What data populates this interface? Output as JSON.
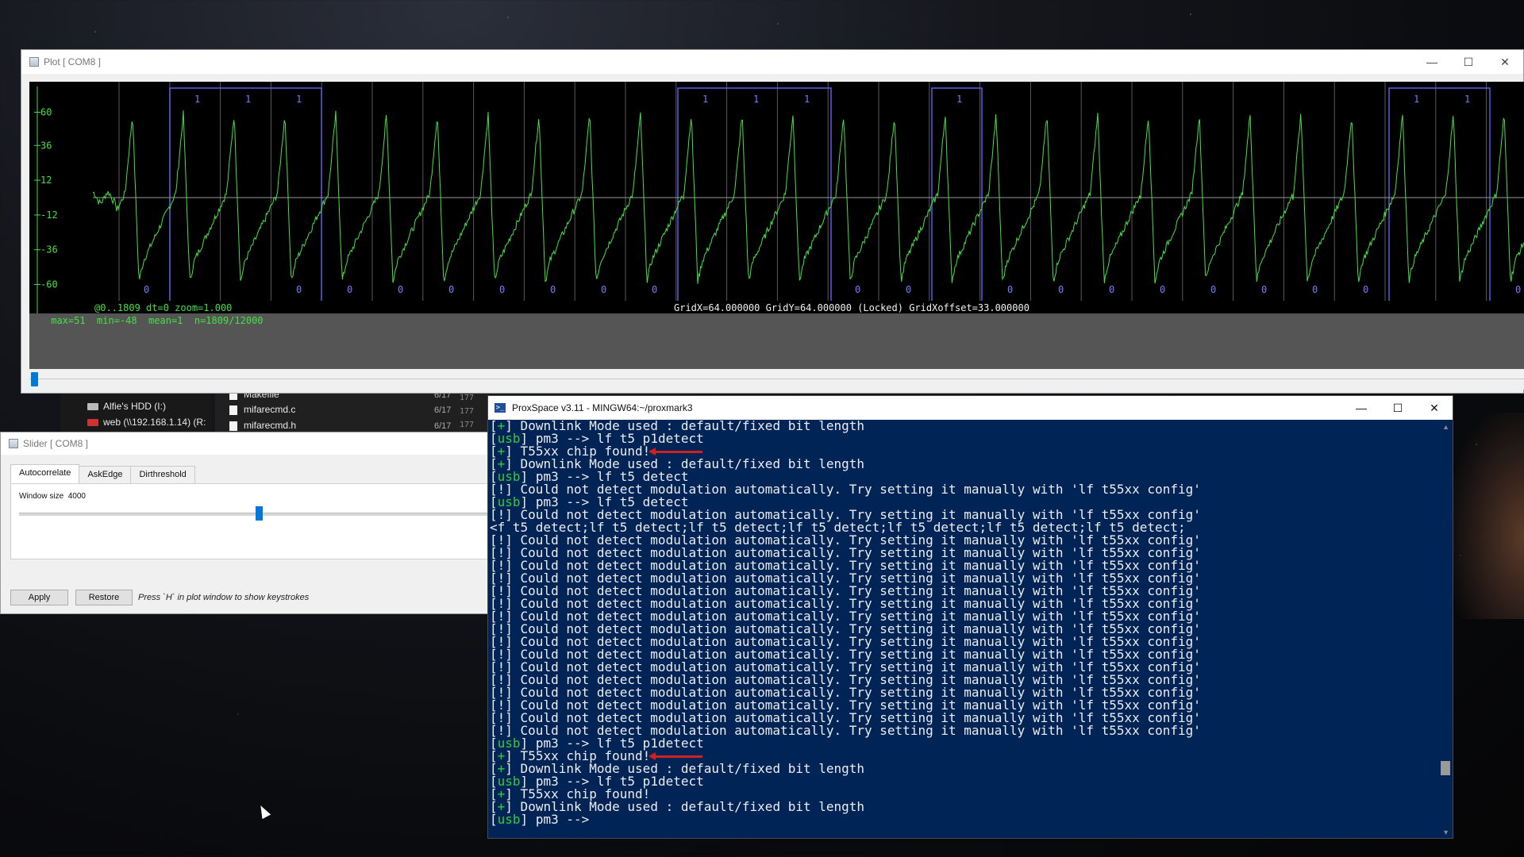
{
  "plot_window": {
    "title": "Plot [ COM8 ]",
    "controls": {
      "minimize": "—",
      "maximize": "☐",
      "close": "✕"
    },
    "y_ticks": [
      "60",
      "36",
      "12",
      "-12",
      "-36",
      "-60"
    ],
    "status_left": "@0..1809  dt=0  zoom=1.000",
    "status_grid": "GridX=64.000000  GridY=64.000000 (Locked) GridXoffset=33.000000",
    "stats": " max=51  min=-48  mean=1  n=1809/12000",
    "bit_labels_top": [
      "1",
      "1",
      "1",
      "1",
      "1",
      "1",
      "1",
      "1",
      "1"
    ],
    "bit_labels_bottom": [
      "0",
      "0",
      "0",
      "0",
      "0",
      "0",
      "0",
      "0",
      "0",
      "0",
      "0",
      "0",
      "0",
      "0",
      "0",
      "0",
      "0",
      "0",
      "0",
      "0"
    ]
  },
  "explorer": {
    "drives": [
      {
        "label": "Alfie's HDD (I:)",
        "icon": "drive-icon"
      },
      {
        "label": "web (\\\\192.168.1.14) (R:",
        "icon": "network-drive-icon"
      }
    ],
    "files": [
      {
        "name": "Makefile",
        "date": "6/17"
      },
      {
        "name": "mifarecmd.c",
        "date": "6/17"
      },
      {
        "name": "mifarecmd.h",
        "date": "6/17"
      }
    ],
    "line_numbers": [
      "177",
      "177",
      "177"
    ]
  },
  "slider_window": {
    "title": "Slider [ COM8 ]",
    "tabs": [
      "Autocorrelate",
      "AskEdge",
      "Dirthreshold"
    ],
    "active_tab": "Autocorrelate",
    "window_size_label": "Window size",
    "window_size_value": "4000",
    "apply_label": "Apply",
    "restore_label": "Restore",
    "hint": "Press `H` in plot window to show keystrokes"
  },
  "terminal": {
    "title": "ProxSpace v3.11 - MINGW64:~/proxmark3",
    "lines": [
      {
        "p": "[+]",
        "t": " Downlink Mode used : default/fixed bit length"
      },
      {
        "p": "[usb]",
        "t": " pm3 --> lf t5 p1detect"
      },
      {
        "p": "[+]",
        "t": " T55xx chip found!",
        "mark": true
      },
      {
        "p": "[+]",
        "t": " Downlink Mode used : default/fixed bit length"
      },
      {
        "p": "[usb]",
        "t": " pm3 --> lf t5 detect"
      },
      {
        "p": "[!]",
        "t": " Could not detect modulation automatically. Try setting it manually with 'lf t55xx config'"
      },
      {
        "p": "[usb]",
        "t": " pm3 --> lf t5 detect"
      },
      {
        "p": "[!]",
        "t": " Could not detect modulation automatically. Try setting it manually with 'lf t55xx config'"
      },
      {
        "p": "",
        "t": "<f t5 detect;lf t5 detect;lf t5 detect;lf t5 detect;lf t5 detect;lf t5 detect;lf t5 detect;"
      },
      {
        "p": "[!]",
        "t": " Could not detect modulation automatically. Try setting it manually with 'lf t55xx config'"
      },
      {
        "p": "[!]",
        "t": " Could not detect modulation automatically. Try setting it manually with 'lf t55xx config'"
      },
      {
        "p": "[!]",
        "t": " Could not detect modulation automatically. Try setting it manually with 'lf t55xx config'"
      },
      {
        "p": "[!]",
        "t": " Could not detect modulation automatically. Try setting it manually with 'lf t55xx config'"
      },
      {
        "p": "[!]",
        "t": " Could not detect modulation automatically. Try setting it manually with 'lf t55xx config'"
      },
      {
        "p": "[!]",
        "t": " Could not detect modulation automatically. Try setting it manually with 'lf t55xx config'"
      },
      {
        "p": "[!]",
        "t": " Could not detect modulation automatically. Try setting it manually with 'lf t55xx config'"
      },
      {
        "p": "[!]",
        "t": " Could not detect modulation automatically. Try setting it manually with 'lf t55xx config'"
      },
      {
        "p": "[!]",
        "t": " Could not detect modulation automatically. Try setting it manually with 'lf t55xx config'"
      },
      {
        "p": "[!]",
        "t": " Could not detect modulation automatically. Try setting it manually with 'lf t55xx config'"
      },
      {
        "p": "[!]",
        "t": " Could not detect modulation automatically. Try setting it manually with 'lf t55xx config'"
      },
      {
        "p": "[!]",
        "t": " Could not detect modulation automatically. Try setting it manually with 'lf t55xx config'"
      },
      {
        "p": "[!]",
        "t": " Could not detect modulation automatically. Try setting it manually with 'lf t55xx config'"
      },
      {
        "p": "[!]",
        "t": " Could not detect modulation automatically. Try setting it manually with 'lf t55xx config'"
      },
      {
        "p": "[!]",
        "t": " Could not detect modulation automatically. Try setting it manually with 'lf t55xx config'"
      },
      {
        "p": "[!]",
        "t": " Could not detect modulation automatically. Try setting it manually with 'lf t55xx config'"
      },
      {
        "p": "[usb]",
        "t": " pm3 --> lf t5 p1detect"
      },
      {
        "p": "[+]",
        "t": " T55xx chip found!",
        "mark": true
      },
      {
        "p": "[+]",
        "t": " Downlink Mode used : default/fixed bit length"
      },
      {
        "p": "[usb]",
        "t": " pm3 --> lf t5 p1detect"
      },
      {
        "p": "[+]",
        "t": " T55xx chip found!"
      },
      {
        "p": "[+]",
        "t": " Downlink Mode used : default/fixed bit length"
      },
      {
        "p": "[usb]",
        "t": " pm3 -->"
      }
    ]
  },
  "colors": {
    "signal": "#45e045",
    "bit_box": "#5a5ae6",
    "terminal_bg": "#012456",
    "accent": "#0078d7",
    "arrow": "#d02020"
  }
}
